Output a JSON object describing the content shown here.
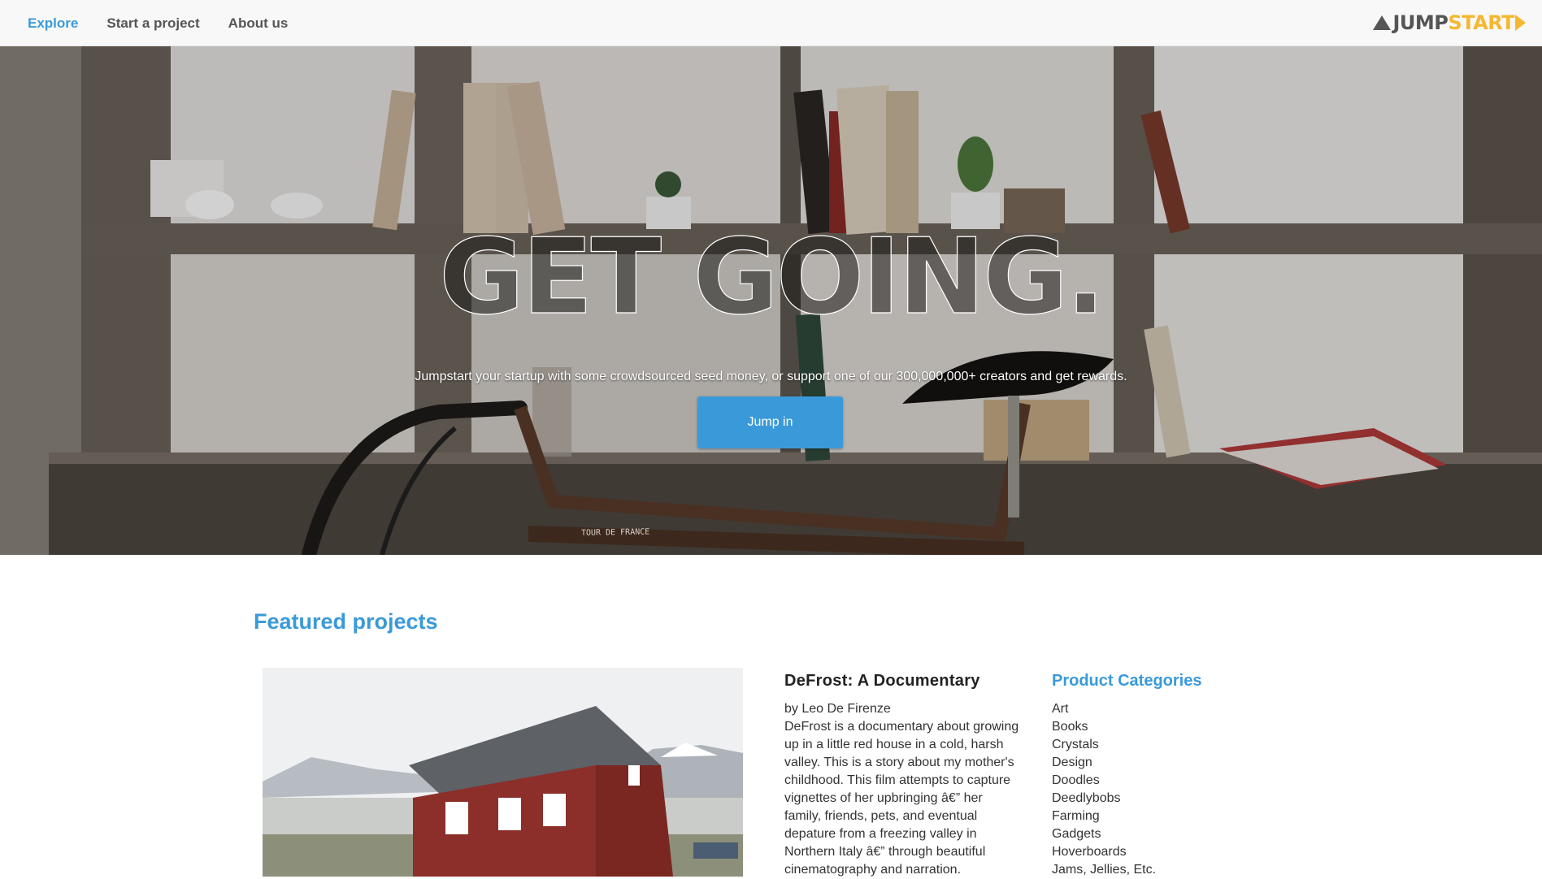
{
  "nav": {
    "links": [
      "Explore",
      "Start a project",
      "About us"
    ],
    "active": "Explore",
    "logo_jump": "JUMP",
    "logo_start": "START"
  },
  "hero": {
    "title": "GET GOING.",
    "subtitle": "Jumpstart your startup with some crowdsourced seed money, or support one of our 300,000,000+ creators and get rewards.",
    "cta": "Jump in",
    "frame_label": "TOUR DE FRANCE"
  },
  "featured": {
    "heading": "Featured projects",
    "project": {
      "title": "DeFrost: A Documentary",
      "author": "by Leo De Firenze",
      "description": "DeFrost is a documentary about growing up in a little red house in a cold, harsh valley. This is a story about my mother's childhood. This film attempts to capture vignettes of her upbringing â€” her family, friends, pets, and eventual depature from a freezing valley in Northern Italy â€” through beautiful cinematography and narration."
    }
  },
  "categories": {
    "title": "Product Categories",
    "items": [
      "Art",
      "Books",
      "Crystals",
      "Design",
      "Doodles",
      "Deedlybobs",
      "Farming",
      "Gadgets",
      "Hoverboards",
      "Jams, Jellies, Etc."
    ]
  },
  "colors": {
    "accent": "#3a9ad9",
    "logo_yellow": "#f5b731",
    "nav_bg": "#f8f8f8"
  }
}
